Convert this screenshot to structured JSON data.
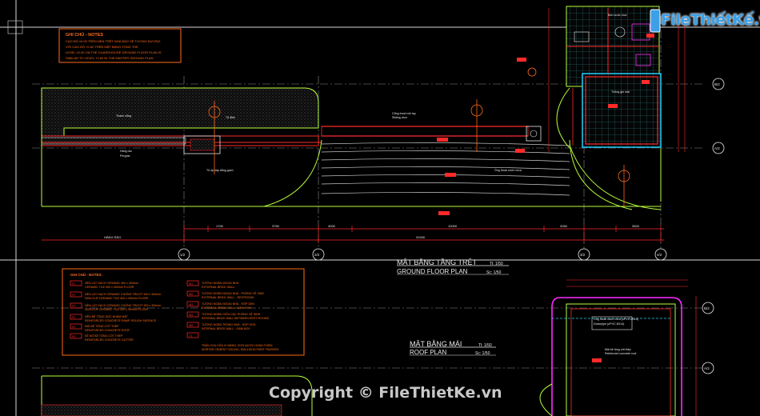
{
  "watermark": {
    "logo_text": "FileThiếtKế.vn",
    "copyright": "Copyright © FileThietKe.vn"
  },
  "notes_top": {
    "title": "GHI CHÚ - NOTES",
    "lines": [
      "CAO ĐỘ ±0.00 TRÊN NỀN TRỆT NHÀ BẢO VỆ TƯƠNG ĐƯƠNG",
      "VỚI CAO ĐỘ +0.60 TRÊN MẶT BẰNG TỔNG THỂ",
      "LEVEL ±0.00 ON THE GUARDHOUSE GROUND FLOOR PLAN IS",
      "SIMILAR TO LEVEL +0.60 IN THE MASTER GROUND PLAN"
    ]
  },
  "notes_bottom": {
    "title": "GHI CHÚ - NOTES:",
    "left": [
      {
        "code": "F1",
        "vi": "NỀN LÁT GẠCH CERAMIC 400 x 400mm",
        "en": "CERAMIC TILE 400 x 400mm FLOOR"
      },
      {
        "code": "F2",
        "vi": "NỀN LÁT GẠCH CERAMIC CHỐNG TRƯỢT 400 x 400mm",
        "en": "NON-SLIP CERAMIC TILE 400 x 400mm FLOOR"
      },
      {
        "code": "F3",
        "vi": "NỀN LÁT GẠCH CERAMIC CHỐNG TRƯỢT 300 x 300mm",
        "en": "NON-SLIP CERAMIC TILE 300 x 300mm FLOOR"
      },
      {
        "code": "F4",
        "vi": "NỀN BÊ TÔNG DỐC NHÁM MẶT",
        "en": "REINFORCED CONCRETE RAMP, ROUGH SURFACE"
      },
      {
        "code": "R1",
        "vi": "MÁI BÊ TÔNG CỐT THÉP",
        "en": "REINFORCED CONCRETE ROOF"
      },
      {
        "code": "R2",
        "vi": "SÊ NÔ BÊ TÔNG CỐT THÉP",
        "en": "REINFORCED CONCRETE GUTTER"
      }
    ],
    "right": [
      {
        "code": "W1",
        "vi": "TƯỜNG NGĂN NGOÀI NHÀ",
        "en": "EXTERNAL BRICK WALL"
      },
      {
        "code": "W2",
        "vi": "TƯỜNG NGĂN NGOÀI NHÀ - PHÒNG VỆ SINH",
        "en": "EXTERNAL BRICK WALL - RESTROOM"
      },
      {
        "code": "W3",
        "vi": "TƯỜNG NGĂN NGOÀI NHÀ - HỘP GEN",
        "en": "EXTERNAL BRICK WALL - GAIN BOX"
      },
      {
        "code": "W4",
        "vi": "TƯỜNG NGĂN GIỮA CÁC PHÒNG VỆ SINH",
        "en": "INTERNAL BRICK WALL BETWEEN REST-ROOMS"
      },
      {
        "code": "W5",
        "vi": "TƯỜNG NGĂN TRONG NHÀ - HỘP GEN",
        "en": "INTERNAL BRICK WALL - GAIN BOX"
      },
      {
        "code": "C1",
        "vi": "TRẦN XOA VỮA XI MĂNG, SƠN NƯỚC HOÀN THIỆN",
        "en": "MORTAR CEMENT CEILING, EMULSION PAINT FINISHED"
      }
    ]
  },
  "titles": {
    "ground_vi": "MẶT BẰNG TẦNG TRỆT",
    "ground_en": "GROUND FLOOR PLAN",
    "ground_scale_vi": "Tl: 1/50",
    "ground_scale_en": "Sc: 1/50",
    "roof_vi": "MẶT BẰNG MÁI",
    "roof_en": "ROOF PLAN",
    "roof_scale_vi": "Tl: 1/50",
    "roof_scale_en": "Sc: 1/50"
  },
  "grid_bubbles": {
    "bottom": [
      "1/2",
      "2/2",
      "3/2",
      "4/2"
    ],
    "right": [
      "B/2",
      "A/2",
      "B/2",
      "A/2"
    ]
  },
  "annotations": [
    "Thành cổng",
    "Hàng rào",
    "Pergola",
    "Cổng trượt mở tay",
    "Sliding door",
    "Tủ ốp xây bằng gạch",
    "Tủ điện",
    "Ống thoát nước mưa",
    "Thông gió mái",
    "Bồn nước inox",
    "Mái bê tông cốt thép",
    "Reinforced concrete roof",
    "Ống thoát nước mưa (uPVC Ø114)",
    "Downpipe (uPVC Ø114)"
  ],
  "colors": {
    "frame": "#d9d9d9",
    "notes": "#ff6a1a",
    "wall_red": "#ff2a2a",
    "landscape_green": "#b8ff3c",
    "dim_white": "#e8e8e8",
    "cyan": "#25d0ff",
    "magenta": "#ff2aff",
    "grid_dash": "#8a8a8a"
  }
}
